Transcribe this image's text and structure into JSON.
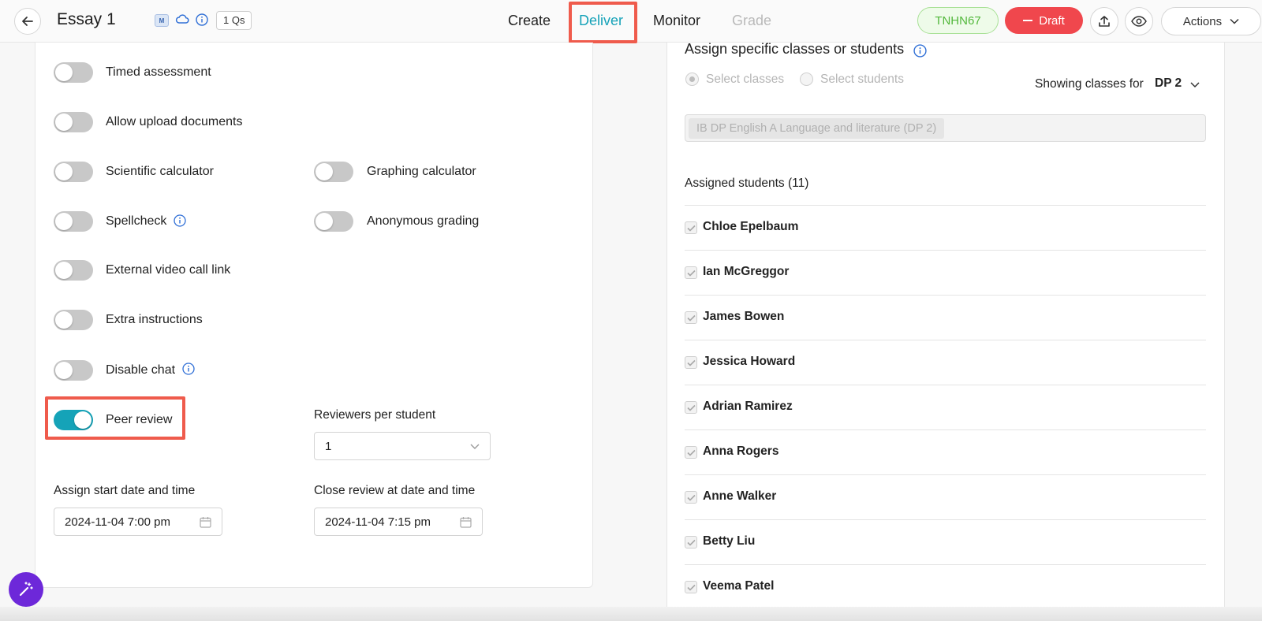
{
  "header": {
    "title": "Essay 1",
    "ms_badge": "M",
    "qs_badge": "1 Qs",
    "nav": [
      "Create",
      "Deliver",
      "Monitor",
      "Grade"
    ],
    "active_tab": "Deliver",
    "join_code": "TNHN67",
    "status": "Draft",
    "actions_label": "Actions"
  },
  "settings": {
    "options": [
      {
        "label": "Timed assessment",
        "on": false
      },
      {
        "label": "Allow upload documents",
        "on": false
      },
      {
        "label": "Scientific calculator",
        "on": false
      },
      {
        "label": "Graphing calculator",
        "on": false
      },
      {
        "label": "Spellcheck",
        "on": false,
        "info": true
      },
      {
        "label": "Anonymous grading",
        "on": false
      },
      {
        "label": "External video call link",
        "on": false
      },
      {
        "label": "Extra instructions",
        "on": false
      },
      {
        "label": "Disable chat",
        "on": false,
        "info": true
      },
      {
        "label": "Peer review",
        "on": true
      }
    ],
    "reviewers_label": "Reviewers per student",
    "reviewers_value": "1",
    "start_label": "Assign start date and time",
    "start_value": "2024-11-04 7:00 pm",
    "close_label": "Close review at date and time",
    "close_value": "2024-11-04 7:15 pm"
  },
  "assign": {
    "title": "Assign specific classes or students",
    "radio_classes": "Select classes",
    "radio_students": "Select students",
    "selected_radio": "Select classes",
    "showing_label": "Showing classes for",
    "showing_value": "DP 2",
    "class_chip": "IB DP English A Language and literature (DP 2)",
    "assigned_heading": "Assigned students (11)",
    "students": [
      "Chloe Epelbaum",
      "Ian McGreggor",
      "James Bowen",
      "Jessica Howard",
      "Adrian Ramirez",
      "Anna Rogers",
      "Anne Walker",
      "Betty Liu",
      "Veema Patel"
    ]
  },
  "colors": {
    "accent": "#15a3b8",
    "draft": "#f0474d",
    "code_green": "#52b83b",
    "highlight": "#ef5b4c",
    "fab": "#6d28d9"
  }
}
